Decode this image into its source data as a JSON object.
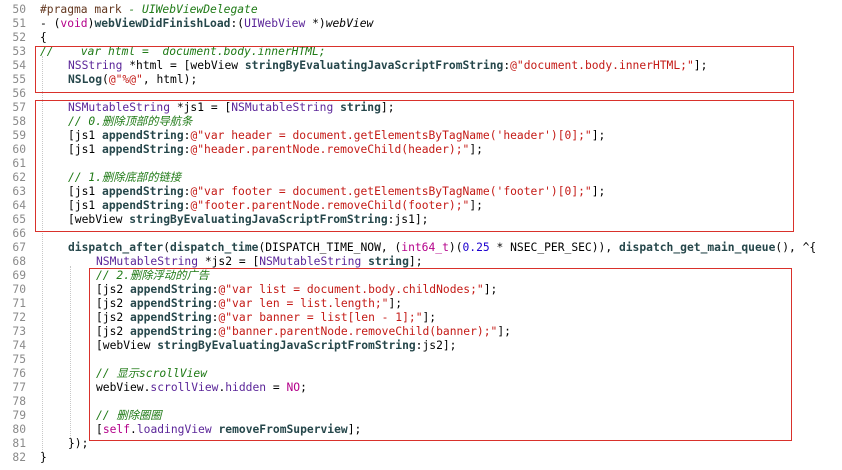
{
  "editor": {
    "lines": [
      {
        "n": "50",
        "indent": 0,
        "tokens": [
          {
            "c": "t-pre",
            "t": "#pragma mark "
          },
          {
            "c": "t-com",
            "t": "- UIWebViewDelegate"
          }
        ]
      },
      {
        "n": "51",
        "indent": 0,
        "tokens": [
          {
            "c": "t-plain",
            "t": "- ("
          },
          {
            "c": "t-kw",
            "t": "void"
          },
          {
            "c": "t-plain",
            "t": ")"
          },
          {
            "c": "t-method",
            "t": "webViewDidFinishLoad"
          },
          {
            "c": "t-plain",
            "t": ":("
          },
          {
            "c": "t-type",
            "t": "UIWebView"
          },
          {
            "c": "t-plain",
            "t": " *)"
          },
          {
            "c": "t-ital",
            "t": "webView"
          }
        ]
      },
      {
        "n": "52",
        "indent": 0,
        "tokens": [
          {
            "c": "t-plain",
            "t": "{"
          }
        ]
      },
      {
        "n": "53",
        "indent": 0,
        "tokens": [
          {
            "c": "t-com",
            "t": "//    var html =  document.body.innerHTML;"
          }
        ]
      },
      {
        "n": "54",
        "indent": 1,
        "tokens": [
          {
            "c": "t-type",
            "t": "NSString"
          },
          {
            "c": "t-plain",
            "t": " *html = [webView "
          },
          {
            "c": "t-method",
            "t": "stringByEvaluatingJavaScriptFromString"
          },
          {
            "c": "t-plain",
            "t": ":"
          },
          {
            "c": "t-str",
            "t": "@\"document.body.innerHTML;\""
          },
          {
            "c": "t-plain",
            "t": "];"
          }
        ]
      },
      {
        "n": "55",
        "indent": 1,
        "tokens": [
          {
            "c": "t-method",
            "t": "NSLog"
          },
          {
            "c": "t-plain",
            "t": "("
          },
          {
            "c": "t-str",
            "t": "@\"%@\""
          },
          {
            "c": "t-plain",
            "t": ", html);"
          }
        ]
      },
      {
        "n": "56",
        "indent": 0,
        "tokens": []
      },
      {
        "n": "57",
        "indent": 1,
        "tokens": [
          {
            "c": "t-type",
            "t": "NSMutableString"
          },
          {
            "c": "t-plain",
            "t": " *js1 = ["
          },
          {
            "c": "t-type",
            "t": "NSMutableString"
          },
          {
            "c": "t-plain",
            "t": " "
          },
          {
            "c": "t-method",
            "t": "string"
          },
          {
            "c": "t-plain",
            "t": "];"
          }
        ]
      },
      {
        "n": "58",
        "indent": 1,
        "tokens": [
          {
            "c": "t-com",
            "t": "// 0.删除顶部的导航条"
          }
        ]
      },
      {
        "n": "59",
        "indent": 1,
        "tokens": [
          {
            "c": "t-plain",
            "t": "[js1 "
          },
          {
            "c": "t-method",
            "t": "appendString"
          },
          {
            "c": "t-plain",
            "t": ":"
          },
          {
            "c": "t-str",
            "t": "@\"var header = document.getElementsByTagName('header')[0];\""
          },
          {
            "c": "t-plain",
            "t": "];"
          }
        ]
      },
      {
        "n": "60",
        "indent": 1,
        "tokens": [
          {
            "c": "t-plain",
            "t": "[js1 "
          },
          {
            "c": "t-method",
            "t": "appendString"
          },
          {
            "c": "t-plain",
            "t": ":"
          },
          {
            "c": "t-str",
            "t": "@\"header.parentNode.removeChild(header);\""
          },
          {
            "c": "t-plain",
            "t": "];"
          }
        ]
      },
      {
        "n": "61",
        "indent": 0,
        "tokens": []
      },
      {
        "n": "62",
        "indent": 1,
        "tokens": [
          {
            "c": "t-com",
            "t": "// 1.删除底部的链接"
          }
        ]
      },
      {
        "n": "63",
        "indent": 1,
        "tokens": [
          {
            "c": "t-plain",
            "t": "[js1 "
          },
          {
            "c": "t-method",
            "t": "appendString"
          },
          {
            "c": "t-plain",
            "t": ":"
          },
          {
            "c": "t-str",
            "t": "@\"var footer = document.getElementsByTagName('footer')[0];\""
          },
          {
            "c": "t-plain",
            "t": "];"
          }
        ]
      },
      {
        "n": "64",
        "indent": 1,
        "tokens": [
          {
            "c": "t-plain",
            "t": "[js1 "
          },
          {
            "c": "t-method",
            "t": "appendString"
          },
          {
            "c": "t-plain",
            "t": ":"
          },
          {
            "c": "t-str",
            "t": "@\"footer.parentNode.removeChild(footer);\""
          },
          {
            "c": "t-plain",
            "t": "];"
          }
        ]
      },
      {
        "n": "65",
        "indent": 1,
        "tokens": [
          {
            "c": "t-plain",
            "t": "[webView "
          },
          {
            "c": "t-method",
            "t": "stringByEvaluatingJavaScriptFromString"
          },
          {
            "c": "t-plain",
            "t": ":js1];"
          }
        ]
      },
      {
        "n": "66",
        "indent": 0,
        "tokens": []
      },
      {
        "n": "67",
        "indent": 1,
        "tokens": [
          {
            "c": "t-method",
            "t": "dispatch_after"
          },
          {
            "c": "t-plain",
            "t": "("
          },
          {
            "c": "t-method",
            "t": "dispatch_time"
          },
          {
            "c": "t-plain",
            "t": "(DISPATCH_TIME_NOW, ("
          },
          {
            "c": "t-kw",
            "t": "int64_t"
          },
          {
            "c": "t-plain",
            "t": ")("
          },
          {
            "c": "t-num",
            "t": "0.25"
          },
          {
            "c": "t-plain",
            "t": " * NSEC_PER_SEC)), "
          },
          {
            "c": "t-method",
            "t": "dispatch_get_main_queue"
          },
          {
            "c": "t-plain",
            "t": "(), ^{"
          }
        ]
      },
      {
        "n": "68",
        "indent": 2,
        "tokens": [
          {
            "c": "t-type",
            "t": "NSMutableString"
          },
          {
            "c": "t-plain",
            "t": " *js2 = ["
          },
          {
            "c": "t-type",
            "t": "NSMutableString"
          },
          {
            "c": "t-plain",
            "t": " "
          },
          {
            "c": "t-method",
            "t": "string"
          },
          {
            "c": "t-plain",
            "t": "];"
          }
        ]
      },
      {
        "n": "69",
        "indent": 2,
        "tokens": [
          {
            "c": "t-com",
            "t": "// 2.删除浮动的广告"
          }
        ]
      },
      {
        "n": "70",
        "indent": 2,
        "tokens": [
          {
            "c": "t-plain",
            "t": "[js2 "
          },
          {
            "c": "t-method",
            "t": "appendString"
          },
          {
            "c": "t-plain",
            "t": ":"
          },
          {
            "c": "t-str",
            "t": "@\"var list = document.body.childNodes;\""
          },
          {
            "c": "t-plain",
            "t": "];"
          }
        ]
      },
      {
        "n": "71",
        "indent": 2,
        "tokens": [
          {
            "c": "t-plain",
            "t": "[js2 "
          },
          {
            "c": "t-method",
            "t": "appendString"
          },
          {
            "c": "t-plain",
            "t": ":"
          },
          {
            "c": "t-str",
            "t": "@\"var len = list.length;\""
          },
          {
            "c": "t-plain",
            "t": "];"
          }
        ]
      },
      {
        "n": "72",
        "indent": 2,
        "tokens": [
          {
            "c": "t-plain",
            "t": "[js2 "
          },
          {
            "c": "t-method",
            "t": "appendString"
          },
          {
            "c": "t-plain",
            "t": ":"
          },
          {
            "c": "t-str",
            "t": "@\"var banner = list[len - 1];\""
          },
          {
            "c": "t-plain",
            "t": "];"
          }
        ]
      },
      {
        "n": "73",
        "indent": 2,
        "tokens": [
          {
            "c": "t-plain",
            "t": "[js2 "
          },
          {
            "c": "t-method",
            "t": "appendString"
          },
          {
            "c": "t-plain",
            "t": ":"
          },
          {
            "c": "t-str",
            "t": "@\"banner.parentNode.removeChild(banner);\""
          },
          {
            "c": "t-plain",
            "t": "];"
          }
        ]
      },
      {
        "n": "74",
        "indent": 2,
        "tokens": [
          {
            "c": "t-plain",
            "t": "[webView "
          },
          {
            "c": "t-method",
            "t": "stringByEvaluatingJavaScriptFromString"
          },
          {
            "c": "t-plain",
            "t": ":js2];"
          }
        ]
      },
      {
        "n": "75",
        "indent": 0,
        "tokens": []
      },
      {
        "n": "76",
        "indent": 2,
        "tokens": [
          {
            "c": "t-com",
            "t": "// 显示scrollView"
          }
        ]
      },
      {
        "n": "77",
        "indent": 2,
        "tokens": [
          {
            "c": "t-plain",
            "t": "webView."
          },
          {
            "c": "t-type",
            "t": "scrollView"
          },
          {
            "c": "t-plain",
            "t": "."
          },
          {
            "c": "t-type",
            "t": "hidden"
          },
          {
            "c": "t-plain",
            "t": " = "
          },
          {
            "c": "t-kw",
            "t": "NO"
          },
          {
            "c": "t-plain",
            "t": ";"
          }
        ]
      },
      {
        "n": "78",
        "indent": 0,
        "tokens": []
      },
      {
        "n": "79",
        "indent": 2,
        "tokens": [
          {
            "c": "t-com",
            "t": "// 删除圈圈"
          }
        ]
      },
      {
        "n": "80",
        "indent": 2,
        "tokens": [
          {
            "c": "t-plain",
            "t": "["
          },
          {
            "c": "t-kw",
            "t": "self"
          },
          {
            "c": "t-plain",
            "t": "."
          },
          {
            "c": "t-type",
            "t": "loadingView"
          },
          {
            "c": "t-plain",
            "t": " "
          },
          {
            "c": "t-method",
            "t": "removeFromSuperview"
          },
          {
            "c": "t-plain",
            "t": "];"
          }
        ]
      },
      {
        "n": "81",
        "indent": 1,
        "tokens": [
          {
            "c": "t-plain",
            "t": "});"
          }
        ]
      },
      {
        "n": "82",
        "indent": 0,
        "tokens": [
          {
            "c": "t-plain",
            "t": "}"
          }
        ]
      }
    ]
  },
  "colors": {
    "highlight_border": "#d9312b",
    "comment": "#1f7a16",
    "string": "#c41a16",
    "keyword": "#b4008a",
    "type": "#5b2699",
    "method": "#26474b",
    "number": "#1c00cf",
    "line_number": "#8a8a8a"
  }
}
